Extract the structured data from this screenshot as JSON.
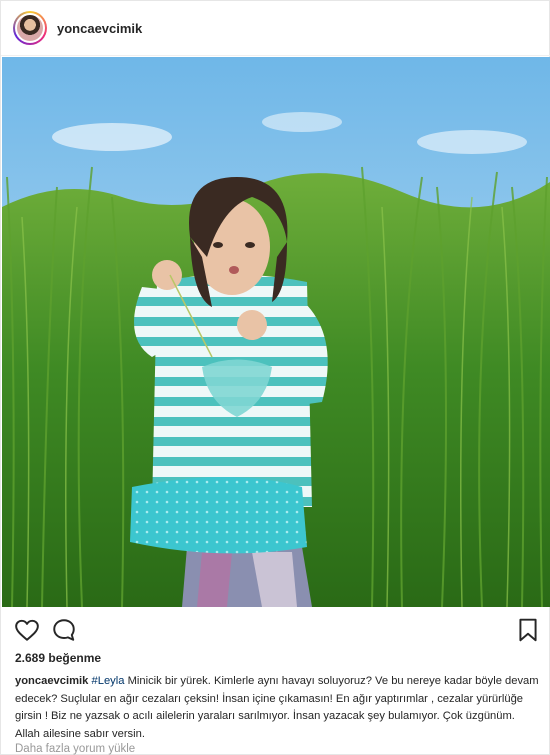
{
  "post": {
    "username": "yoncaevcimik",
    "likes_text": "2.689 beğenme",
    "caption": {
      "username": "yoncaevcimik",
      "hashtag": "#Leyla",
      "text": " Minicik bir yürek. Kimlerle aynı havayı soluyoruz? Ve bu nereye kadar böyle devam edecek? Suçlular en ağır cezaları çeksin! İnsan içine çıkamasın! En ağır yaptırımlar , cezalar yürürlüğe girsin ! Biz ne yazsak o acılı ailelerin yaraları sarılmıyor. İnsan yazacak şey bulamıyor. Çok üzgünüm. Allah ailesine sabır versin."
    },
    "load_more_comments": "Daha fazla yorum yükle"
  },
  "icons": {
    "like": "heart-icon",
    "comment": "comment-icon",
    "save": "bookmark-icon"
  },
  "colors": {
    "text": "#262626",
    "hashtag": "#003569",
    "muted": "#999999",
    "border": "#efefef"
  }
}
